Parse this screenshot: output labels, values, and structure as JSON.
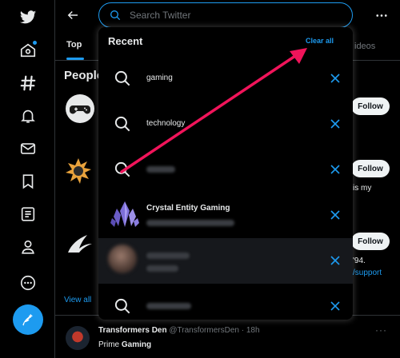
{
  "search": {
    "placeholder": "Search Twitter"
  },
  "tabs": {
    "top": "Top",
    "videos_partial": "ideos"
  },
  "people": {
    "heading": "People",
    "follow_label": "Follow",
    "peek_texts": [
      "is my",
      "'94.",
      "/support"
    ],
    "view_all": "View all"
  },
  "recent": {
    "heading": "Recent",
    "clear_all": "Clear all",
    "items": [
      {
        "type": "query",
        "text": "gaming"
      },
      {
        "type": "query",
        "text": "technology"
      },
      {
        "type": "query",
        "text": ""
      },
      {
        "type": "account",
        "name": "Crystal Entity Gaming"
      },
      {
        "type": "account",
        "name": ""
      },
      {
        "type": "query",
        "text": ""
      }
    ]
  },
  "feed": {
    "name": "Transformers Den",
    "handle": "@TransformersDen",
    "time": "· 18h",
    "text_plain": "Prime ",
    "text_bold": "Gaming"
  },
  "colors": {
    "accent": "#1d9bf0",
    "annotation_arrow": "#f0145a",
    "background": "#000000"
  },
  "icons": [
    "twitter-logo-icon",
    "home-icon",
    "hashtag-icon",
    "bell-icon",
    "mail-icon",
    "bookmark-icon",
    "list-icon",
    "profile-icon",
    "more-circle-icon",
    "compose-icon",
    "back-arrow-icon",
    "search-icon",
    "ellipsis-icon",
    "close-icon"
  ]
}
